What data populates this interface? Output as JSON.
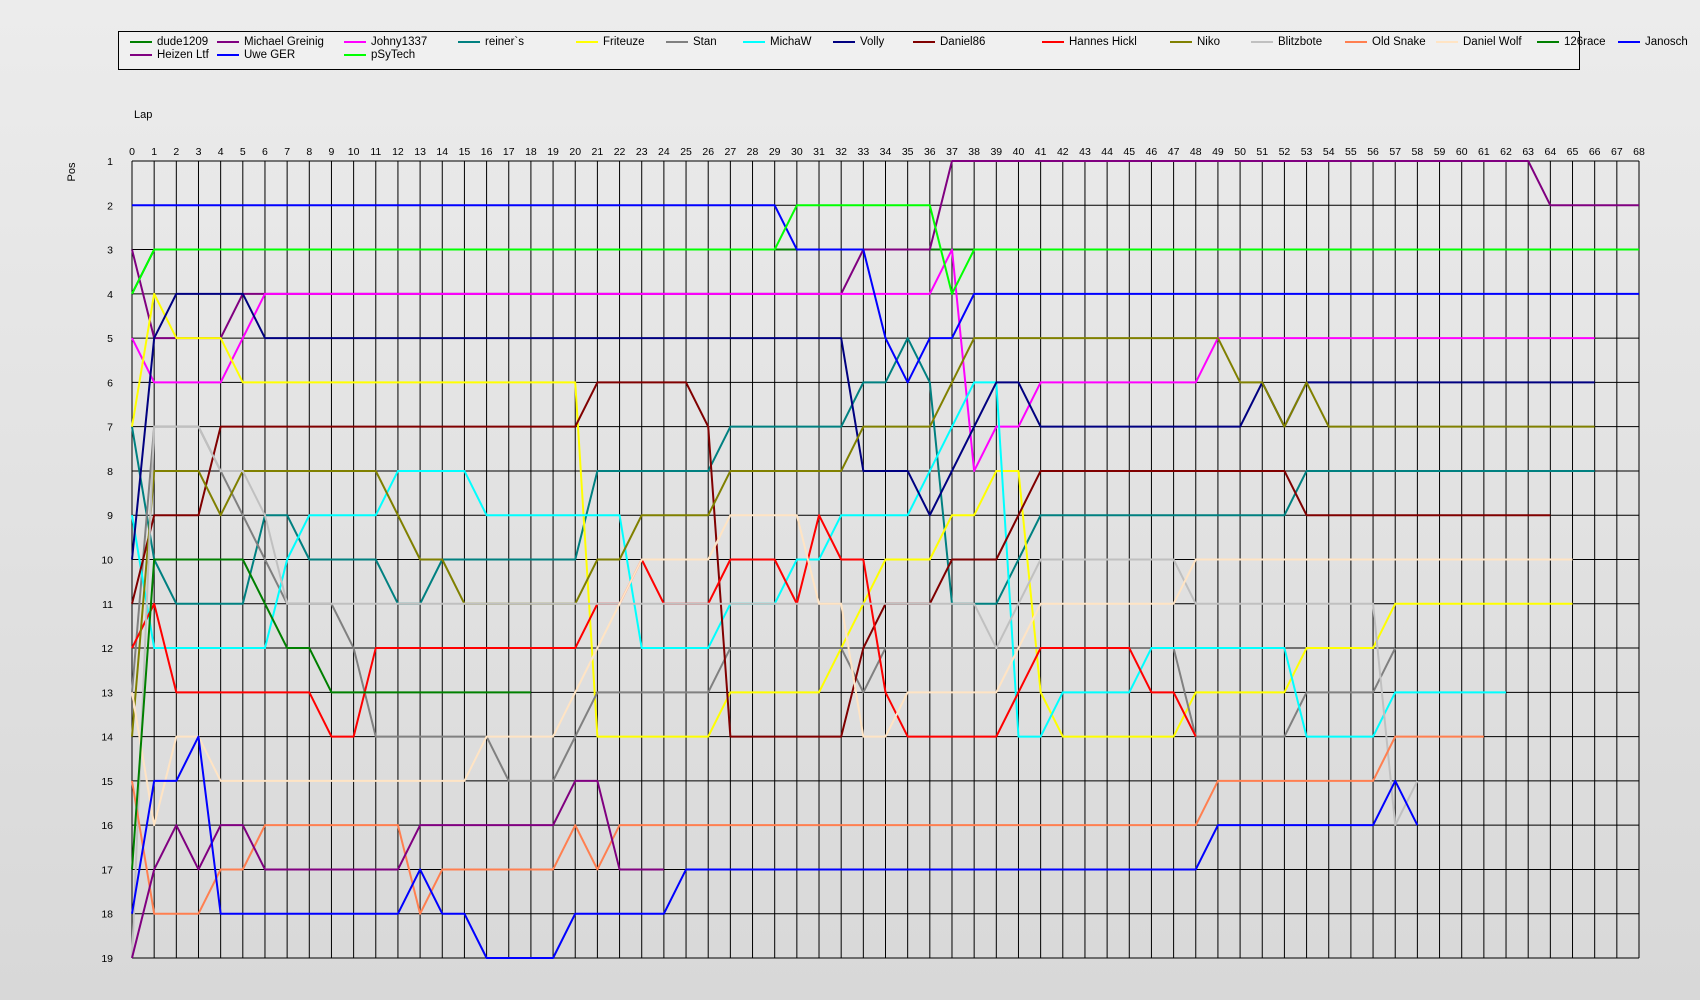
{
  "chart_data": {
    "type": "line",
    "title": "",
    "xlabel": "Lap",
    "ylabel": "Pos",
    "x": [
      0,
      1,
      2,
      3,
      4,
      5,
      6,
      7,
      8,
      9,
      10,
      11,
      12,
      13,
      14,
      15,
      16,
      17,
      18,
      19,
      20,
      21,
      22,
      23,
      24,
      25,
      26,
      27,
      28,
      29,
      30,
      31,
      32,
      33,
      34,
      35,
      36,
      37,
      38,
      39,
      40,
      41,
      42,
      43,
      44,
      45,
      46,
      47,
      48,
      49,
      50,
      51,
      52,
      53,
      54,
      55,
      56,
      57,
      58,
      59,
      60,
      61,
      62,
      63,
      64,
      65,
      66,
      67,
      68
    ],
    "y_ticks": [
      1,
      2,
      3,
      4,
      5,
      6,
      7,
      8,
      9,
      10,
      11,
      12,
      13,
      14,
      15,
      16,
      17,
      18,
      19
    ],
    "xlim": [
      0,
      68
    ],
    "ylim": [
      1,
      19
    ],
    "y_inverted": true,
    "grid": true,
    "legend_position": "top",
    "series": [
      {
        "name": "dude1209",
        "color": "#008000",
        "values": [
          4,
          3,
          3,
          3,
          3,
          3,
          3,
          3,
          3,
          3,
          3,
          3,
          3,
          3,
          3,
          3,
          3,
          3,
          3,
          3,
          3,
          3,
          3,
          3,
          3,
          3,
          3,
          3,
          3,
          3,
          3,
          3,
          3,
          3,
          3,
          3,
          3,
          3,
          3,
          3,
          3,
          3,
          3,
          3,
          3,
          3,
          3,
          3,
          3,
          3,
          3,
          3,
          3,
          3,
          3,
          3,
          3,
          3,
          3,
          3,
          3,
          3,
          3,
          3,
          3,
          3,
          3,
          3,
          3
        ]
      },
      {
        "name": "Michael Greinig",
        "color": "#800080",
        "values": [
          3,
          5,
          5,
          5,
          5,
          4,
          4,
          4,
          4,
          4,
          4,
          4,
          4,
          4,
          4,
          4,
          4,
          4,
          4,
          4,
          4,
          4,
          4,
          4,
          4,
          4,
          4,
          4,
          4,
          4,
          4,
          4,
          4,
          3,
          3,
          3,
          3,
          1,
          1,
          1,
          1,
          1,
          1,
          1,
          1,
          1,
          1,
          1,
          1,
          1,
          1,
          1,
          1,
          1,
          1,
          1,
          1,
          1,
          1,
          1,
          1,
          1,
          1,
          1,
          2,
          2,
          2,
          2,
          2
        ]
      },
      {
        "name": "Johny1337",
        "color": "#ff00ff",
        "values": [
          5,
          6,
          6,
          6,
          6,
          5,
          4,
          4,
          4,
          4,
          4,
          4,
          4,
          4,
          4,
          4,
          4,
          4,
          4,
          4,
          4,
          4,
          4,
          4,
          4,
          4,
          4,
          4,
          4,
          4,
          4,
          4,
          4,
          4,
          4,
          4,
          4,
          3,
          8,
          7,
          7,
          6,
          6,
          6,
          6,
          6,
          6,
          6,
          6,
          5,
          5,
          5,
          5,
          5,
          5,
          5,
          5,
          5,
          5,
          5,
          5,
          5,
          5,
          5,
          5,
          5,
          5
        ]
      },
      {
        "name": "reiner`s",
        "color": "#008080",
        "values": [
          7,
          10,
          11,
          11,
          11,
          11,
          9,
          9,
          10,
          10,
          10,
          10,
          11,
          11,
          10,
          10,
          10,
          10,
          10,
          10,
          10,
          8,
          8,
          8,
          8,
          8,
          8,
          7,
          7,
          7,
          7,
          7,
          7,
          6,
          6,
          5,
          6,
          11,
          11,
          11,
          10,
          9,
          9,
          9,
          9,
          9,
          9,
          9,
          9,
          9,
          9,
          9,
          9,
          8,
          8,
          8,
          8,
          8,
          8,
          8,
          8,
          8,
          8,
          8,
          8,
          8,
          8
        ]
      },
      {
        "name": "Friteuze",
        "color": "#ffff00",
        "values": [
          7,
          4,
          5,
          5,
          5,
          6,
          6,
          6,
          6,
          6,
          6,
          6,
          6,
          6,
          6,
          6,
          6,
          6,
          6,
          6,
          6,
          14,
          14,
          14,
          14,
          14,
          14,
          13,
          13,
          13,
          13,
          13,
          12,
          11,
          10,
          10,
          10,
          9,
          9,
          8,
          8,
          13,
          14,
          14,
          14,
          14,
          14,
          14,
          13,
          13,
          13,
          13,
          13,
          12,
          12,
          12,
          12,
          11,
          11,
          11,
          11,
          11,
          11,
          11,
          11,
          11
        ]
      },
      {
        "name": "Stan",
        "color": "#808080",
        "values": [
          13,
          7,
          7,
          7,
          8,
          9,
          10,
          11,
          11,
          11,
          12,
          14,
          14,
          14,
          14,
          14,
          14,
          15,
          15,
          15,
          14,
          13,
          13,
          13,
          13,
          13,
          13,
          12,
          12,
          12,
          12,
          12,
          12,
          13,
          12,
          12,
          12,
          12,
          12,
          12,
          12,
          12,
          12,
          12,
          12,
          12,
          12,
          12,
          14,
          14,
          14,
          14,
          14,
          13,
          13,
          13,
          13,
          12
        ]
      },
      {
        "name": "MichaW",
        "color": "#00ffff",
        "values": [
          9,
          12,
          12,
          12,
          12,
          12,
          12,
          10,
          9,
          9,
          9,
          9,
          8,
          8,
          8,
          8,
          9,
          9,
          9,
          9,
          9,
          9,
          9,
          12,
          12,
          12,
          12,
          11,
          11,
          11,
          10,
          10,
          9,
          9,
          9,
          9,
          8,
          7,
          6,
          6,
          14,
          14,
          13,
          13,
          13,
          13,
          12,
          12,
          12,
          12,
          12,
          12,
          12,
          14,
          14,
          14,
          14,
          13,
          13,
          13,
          13,
          13,
          13
        ]
      },
      {
        "name": "Volly",
        "color": "#000080",
        "values": [
          10,
          5,
          4,
          4,
          4,
          4,
          5,
          5,
          5,
          5,
          5,
          5,
          5,
          5,
          5,
          5,
          5,
          5,
          5,
          5,
          5,
          5,
          5,
          5,
          5,
          5,
          5,
          5,
          5,
          5,
          5,
          5,
          5,
          8,
          8,
          8,
          9,
          8,
          7,
          6,
          6,
          7,
          7,
          7,
          7,
          7,
          7,
          7,
          7,
          7,
          7,
          6,
          7,
          6,
          6,
          6,
          6,
          6,
          6,
          6,
          6,
          6,
          6,
          6,
          6,
          6,
          6
        ]
      },
      {
        "name": "Daniel86",
        "color": "#800000",
        "values": [
          11,
          9,
          9,
          9,
          7,
          7,
          7,
          7,
          7,
          7,
          7,
          7,
          7,
          7,
          7,
          7,
          7,
          7,
          7,
          7,
          7,
          6,
          6,
          6,
          6,
          6,
          7,
          14,
          14,
          14,
          14,
          14,
          14,
          12,
          11,
          11,
          11,
          10,
          10,
          10,
          9,
          8,
          8,
          8,
          8,
          8,
          8,
          8,
          8,
          8,
          8,
          8,
          8,
          9,
          9,
          9,
          9,
          9,
          9,
          9,
          9,
          9,
          9,
          9,
          9
        ]
      },
      {
        "name": "Hannes Hickl",
        "color": "#ff0000",
        "values": [
          12,
          11,
          13,
          13,
          13,
          13,
          13,
          13,
          13,
          14,
          14,
          12,
          12,
          12,
          12,
          12,
          12,
          12,
          12,
          12,
          12,
          11,
          11,
          10,
          11,
          11,
          11,
          10,
          10,
          10,
          11,
          9,
          10,
          10,
          13,
          14,
          14,
          14,
          14,
          14,
          13,
          12,
          12,
          12,
          12,
          12,
          13,
          13,
          14
        ]
      },
      {
        "name": "Niko",
        "color": "#808000",
        "values": [
          14,
          8,
          8,
          8,
          9,
          8,
          8,
          8,
          8,
          8,
          8,
          8,
          9,
          10,
          10,
          11,
          11,
          11,
          11,
          11,
          11,
          10,
          10,
          9,
          9,
          9,
          9,
          8,
          8,
          8,
          8,
          8,
          8,
          7,
          7,
          7,
          7,
          6,
          5,
          5,
          5,
          5,
          5,
          5,
          5,
          5,
          5,
          5,
          5,
          5,
          6,
          6,
          7,
          6,
          7,
          7,
          7,
          7,
          7,
          7,
          7,
          7,
          7,
          7,
          7,
          7,
          7
        ]
      },
      {
        "name": "Blitzbote",
        "color": "#c0c0c0",
        "values": [
          19,
          7,
          7,
          7,
          8,
          8,
          9,
          11,
          11,
          11,
          11,
          11,
          11,
          11,
          11,
          11,
          11,
          11,
          11,
          11,
          11,
          11,
          11,
          11,
          11,
          11,
          11,
          11,
          11,
          11,
          11,
          11,
          11,
          11,
          11,
          11,
          11,
          11,
          11,
          12,
          11,
          10,
          10,
          10,
          10,
          10,
          10,
          10,
          11,
          11,
          11,
          11,
          11,
          11,
          11,
          11,
          11,
          16,
          15
        ]
      },
      {
        "name": "Old Snake",
        "color": "#ff7f50",
        "values": [
          15,
          18,
          18,
          18,
          17,
          17,
          16,
          16,
          16,
          16,
          16,
          16,
          16,
          18,
          17,
          17,
          17,
          17,
          17,
          17,
          16,
          17,
          16,
          16,
          16,
          16,
          16,
          16,
          16,
          16,
          16,
          16,
          16,
          16,
          16,
          16,
          16,
          16,
          16,
          16,
          16,
          16,
          16,
          16,
          16,
          16,
          16,
          16,
          16,
          15,
          15,
          15,
          15,
          15,
          15,
          15,
          15,
          14,
          14,
          14,
          14,
          14
        ]
      },
      {
        "name": "Daniel Wolf",
        "color": "#ffe4c4",
        "values": [
          13,
          16,
          14,
          14,
          15,
          15,
          15,
          15,
          15,
          15,
          15,
          15,
          15,
          15,
          15,
          15,
          14,
          14,
          14,
          14,
          13,
          12,
          11,
          10,
          10,
          10,
          10,
          9,
          9,
          9,
          9,
          11,
          11,
          14,
          14,
          13,
          13,
          13,
          13,
          13,
          12,
          11,
          11,
          11,
          11,
          11,
          11,
          11,
          10,
          10,
          10,
          10,
          10,
          10,
          10,
          10,
          10,
          10,
          10,
          10,
          10,
          10,
          10,
          10,
          10,
          10
        ]
      },
      {
        "name": "126race",
        "color": "#008000",
        "values": [
          17,
          10,
          10,
          10,
          10,
          10,
          11,
          12,
          12,
          13,
          13,
          13,
          13,
          13,
          13,
          13,
          13,
          13,
          13
        ]
      },
      {
        "name": "Janosch",
        "color": "#0000ff",
        "values": [
          2,
          2,
          2,
          2,
          2,
          2,
          2,
          2,
          2,
          2,
          2,
          2,
          2,
          2,
          2,
          2,
          2,
          2,
          2,
          2,
          2,
          2,
          2,
          2,
          2,
          2,
          2,
          2,
          2,
          2,
          3,
          3,
          3,
          3,
          5,
          6,
          5,
          5,
          4,
          4,
          4,
          4,
          4,
          4,
          4,
          4,
          4,
          4,
          4,
          4,
          4,
          4,
          4,
          4,
          4,
          4,
          4,
          4,
          4,
          4,
          4,
          4,
          4,
          4,
          4,
          4,
          4,
          4,
          4
        ]
      },
      {
        "name": "Heizen Ltf",
        "color": "#800080",
        "values": [
          19,
          17,
          16,
          17,
          16,
          16,
          17,
          17,
          17,
          17,
          17,
          17,
          17,
          16,
          16,
          16,
          16,
          16,
          16,
          16,
          15,
          15,
          17,
          17,
          17
        ]
      },
      {
        "name": "Uwe GER",
        "color": "#0000ff",
        "values": [
          18,
          15,
          15,
          14,
          18,
          18,
          18,
          18,
          18,
          18,
          18,
          18,
          18,
          17,
          18,
          18,
          19,
          19,
          19,
          19,
          18,
          18,
          18,
          18,
          18,
          17,
          17,
          17,
          17,
          17,
          17,
          17,
          17,
          17,
          17,
          17,
          17,
          17,
          17,
          17,
          17,
          17,
          17,
          17,
          17,
          17,
          17,
          17,
          17,
          16,
          16,
          16,
          16,
          16,
          16,
          16,
          16,
          15,
          16
        ]
      },
      {
        "name": "pSyTech",
        "color": "#00ff00",
        "values": [
          4,
          3,
          3,
          3,
          3,
          3,
          3,
          3,
          3,
          3,
          3,
          3,
          3,
          3,
          3,
          3,
          3,
          3,
          3,
          3,
          3,
          3,
          3,
          3,
          3,
          3,
          3,
          3,
          3,
          3,
          2,
          2,
          2,
          2,
          2,
          2,
          2,
          4,
          3,
          3,
          3,
          3,
          3,
          3,
          3,
          3,
          3,
          3,
          3,
          3,
          3,
          3,
          3,
          3,
          3,
          3,
          3,
          3,
          3,
          3,
          3,
          3,
          3,
          3,
          3,
          3,
          3,
          3,
          3
        ]
      }
    ]
  }
}
